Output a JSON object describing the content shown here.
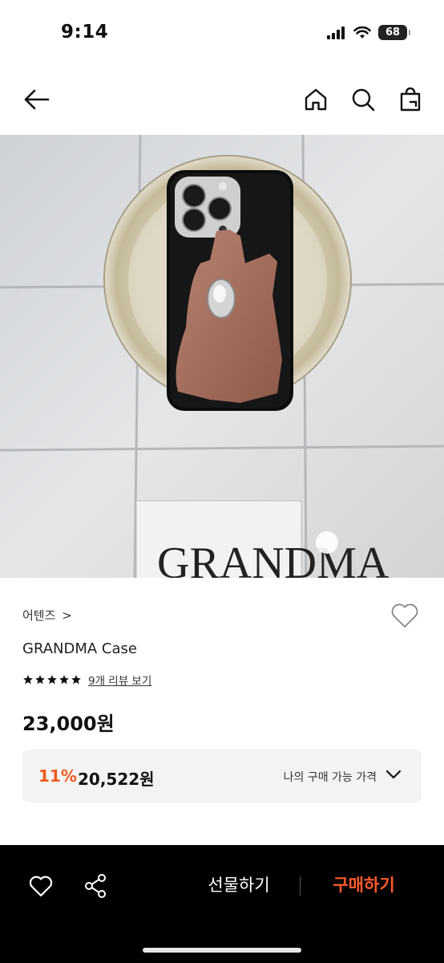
{
  "status_bar": {
    "time": "9:14",
    "battery": "68"
  },
  "nav": {
    "back_icon": "arrow-left-icon",
    "home_icon": "home-icon",
    "search_icon": "search-icon",
    "bag_icon": "shopping-bag-icon"
  },
  "product": {
    "image_label": "GRANDMA",
    "brand": "어텐즈",
    "brand_chevron": ">",
    "name": "GRANDMA Case",
    "rating_stars": 5,
    "review_link": "9개 리뷰 보기",
    "price": "23,000원",
    "discount": {
      "percent": "11%",
      "price": "20,522원",
      "label": "나의 구매 가능 가격"
    }
  },
  "bottom_bar": {
    "wish_icon": "heart-icon",
    "share_icon": "share-icon",
    "gift_label": "선물하기",
    "buy_label": "구매하기"
  },
  "colors": {
    "accent": "#ee5a1e",
    "buy": "#ff5a2a",
    "bottom_bar_bg": "#000000",
    "price_box_bg": "#f3f3f3"
  }
}
